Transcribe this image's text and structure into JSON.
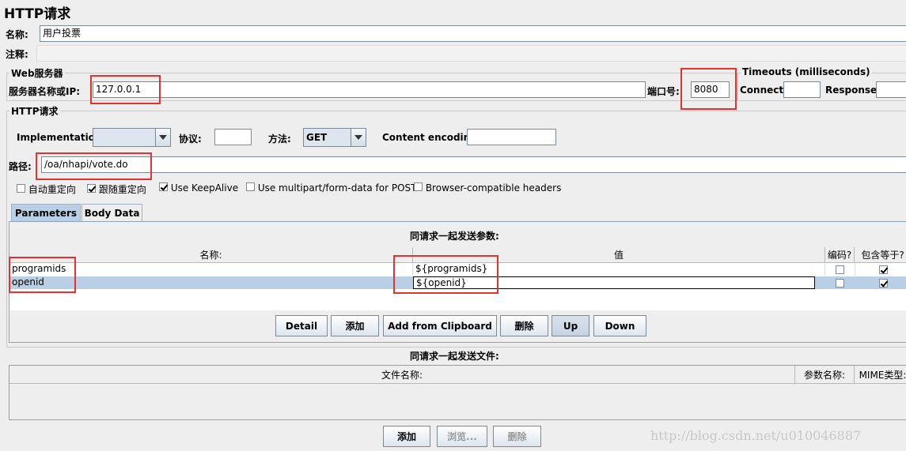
{
  "title": "HTTP请求",
  "name_row": {
    "label": "名称:",
    "value": "用户投票"
  },
  "comment_row": {
    "label": "注释:"
  },
  "web_server": {
    "group_title": "Web服务器",
    "server_label": "服务器名称或IP:",
    "server_value": "127.0.0.1",
    "port_label": "端口号:",
    "port_value": "8080"
  },
  "timeouts": {
    "group_title": "Timeouts (milliseconds)",
    "connect_label": "Connect:",
    "response_label": "Response:"
  },
  "http_request": {
    "group_title": "HTTP请求",
    "implementation_label": "Implementation:",
    "implementation_value": "",
    "protocol_label": "协议:",
    "protocol_value": "",
    "method_label": "方法:",
    "method_value": "GET",
    "encoding_label": "Content encoding:",
    "encoding_value": "",
    "path_label": "路径:",
    "path_value": "/oa/nhapi/vote.do"
  },
  "options": [
    {
      "label": "自动重定向",
      "checked": false
    },
    {
      "label": "跟随重定向",
      "checked": true
    },
    {
      "label": "Use KeepAlive",
      "checked": true
    },
    {
      "label": "Use multipart/form-data for POST",
      "checked": false
    },
    {
      "label": "Browser-compatible headers",
      "checked": false
    }
  ],
  "tabs": [
    {
      "label": "Parameters",
      "active": true
    },
    {
      "label": "Body Data",
      "active": false
    }
  ],
  "params": {
    "heading": "同请求一起发送参数:",
    "columns": [
      "名称:",
      "值",
      "编码?",
      "包含等于?"
    ],
    "rows": [
      {
        "name": "programids",
        "value": "${programids}",
        "encode": false,
        "include_equals": true
      },
      {
        "name": "openid",
        "value": "${openid}",
        "encode": false,
        "include_equals": true
      }
    ],
    "buttons": [
      "Detail",
      "添加",
      "Add from Clipboard",
      "删除",
      "Up",
      "Down"
    ]
  },
  "files": {
    "heading": "同请求一起发送文件:",
    "columns": [
      "文件名称:",
      "参数名称:",
      "MIME类型:"
    ],
    "buttons": [
      "添加",
      "浏览...",
      "删除"
    ]
  },
  "watermark": "http://blog.csdn.net/u010046887",
  "colors": {
    "selection": "#b8cfe5",
    "highlight_box": "#e8302c",
    "tab_active": "#b8cfe5"
  }
}
